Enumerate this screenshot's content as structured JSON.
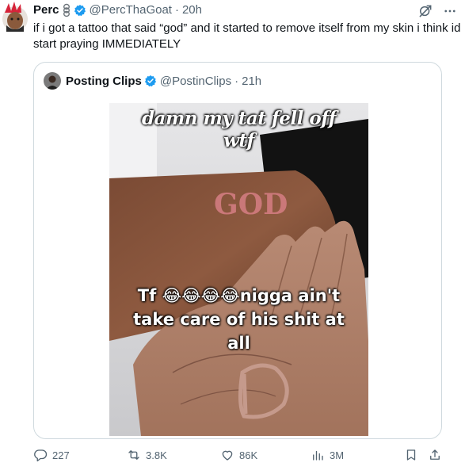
{
  "tweet": {
    "author_name": "Perc",
    "author_handle": "@PercThaGoat",
    "time": "20h",
    "separator": "·",
    "text": "if i got a tattoo that said “god” and it started to remove itself from my skin i think id start praying IMMEDIATELY"
  },
  "quote": {
    "author_name": "Posting Clips",
    "author_handle": "@PostinClips",
    "time": "21h",
    "separator": "·",
    "media": {
      "caption_top_line1": "damn my tat fell off",
      "caption_top_line2": "wtf",
      "caption_mid_line1": "Tf 😂😂😂😂nigga ain't",
      "caption_mid_line2": "take care of his shit at",
      "caption_mid_line3": "all",
      "tattoo_text": "GOD"
    }
  },
  "actions": {
    "replies": "227",
    "reposts": "3.8K",
    "likes": "86K",
    "views": "3M"
  },
  "colors": {
    "verified": "#1d9bf0",
    "secondary_text": "#536471",
    "border": "#cfd9de"
  }
}
